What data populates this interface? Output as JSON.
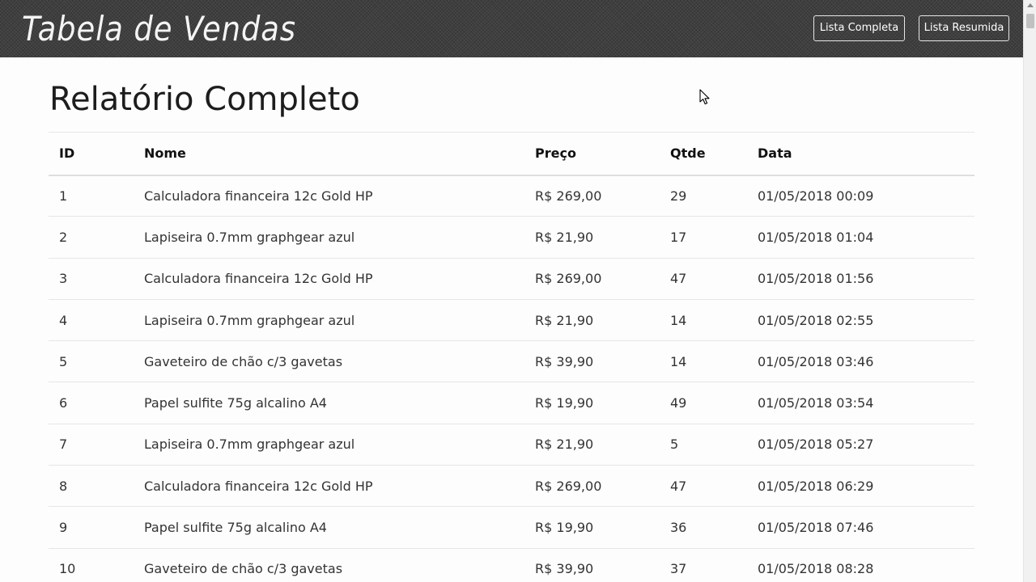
{
  "header": {
    "brand": "Tabela de Vendas",
    "buttons": [
      "Lista Completa",
      "Lista Resumida"
    ]
  },
  "main": {
    "title": "Relatório Completo"
  },
  "table": {
    "columns": [
      "ID",
      "Nome",
      "Preço",
      "Qtde",
      "Data"
    ],
    "rows": [
      [
        "1",
        "Calculadora financeira 12c Gold HP",
        "R$ 269,00",
        "29",
        "01/05/2018 00:09"
      ],
      [
        "2",
        "Lapiseira 0.7mm graphgear azul",
        "R$ 21,90",
        "17",
        "01/05/2018 01:04"
      ],
      [
        "3",
        "Calculadora financeira 12c Gold HP",
        "R$ 269,00",
        "47",
        "01/05/2018 01:56"
      ],
      [
        "4",
        "Lapiseira 0.7mm graphgear azul",
        "R$ 21,90",
        "14",
        "01/05/2018 02:55"
      ],
      [
        "5",
        "Gaveteiro de chão c/3 gavetas",
        "R$ 39,90",
        "14",
        "01/05/2018 03:46"
      ],
      [
        "6",
        "Papel sulfite 75g alcalino A4",
        "R$ 19,90",
        "49",
        "01/05/2018 03:54"
      ],
      [
        "7",
        "Lapiseira 0.7mm graphgear azul",
        "R$ 21,90",
        "5",
        "01/05/2018 05:27"
      ],
      [
        "8",
        "Calculadora financeira 12c Gold HP",
        "R$ 269,00",
        "47",
        "01/05/2018 06:29"
      ],
      [
        "9",
        "Papel sulfite 75g alcalino A4",
        "R$ 19,90",
        "36",
        "01/05/2018 07:46"
      ],
      [
        "10",
        "Gaveteiro de chão c/3 gavetas",
        "R$ 39,90",
        "37",
        "01/05/2018 08:28"
      ]
    ]
  },
  "colors": {
    "navbar": "#3f3f3f",
    "page_background": "#fdfdfd",
    "row_divider": "#e6e6e6"
  },
  "icons": {
    "cursor": "mouse-pointer-icon"
  }
}
